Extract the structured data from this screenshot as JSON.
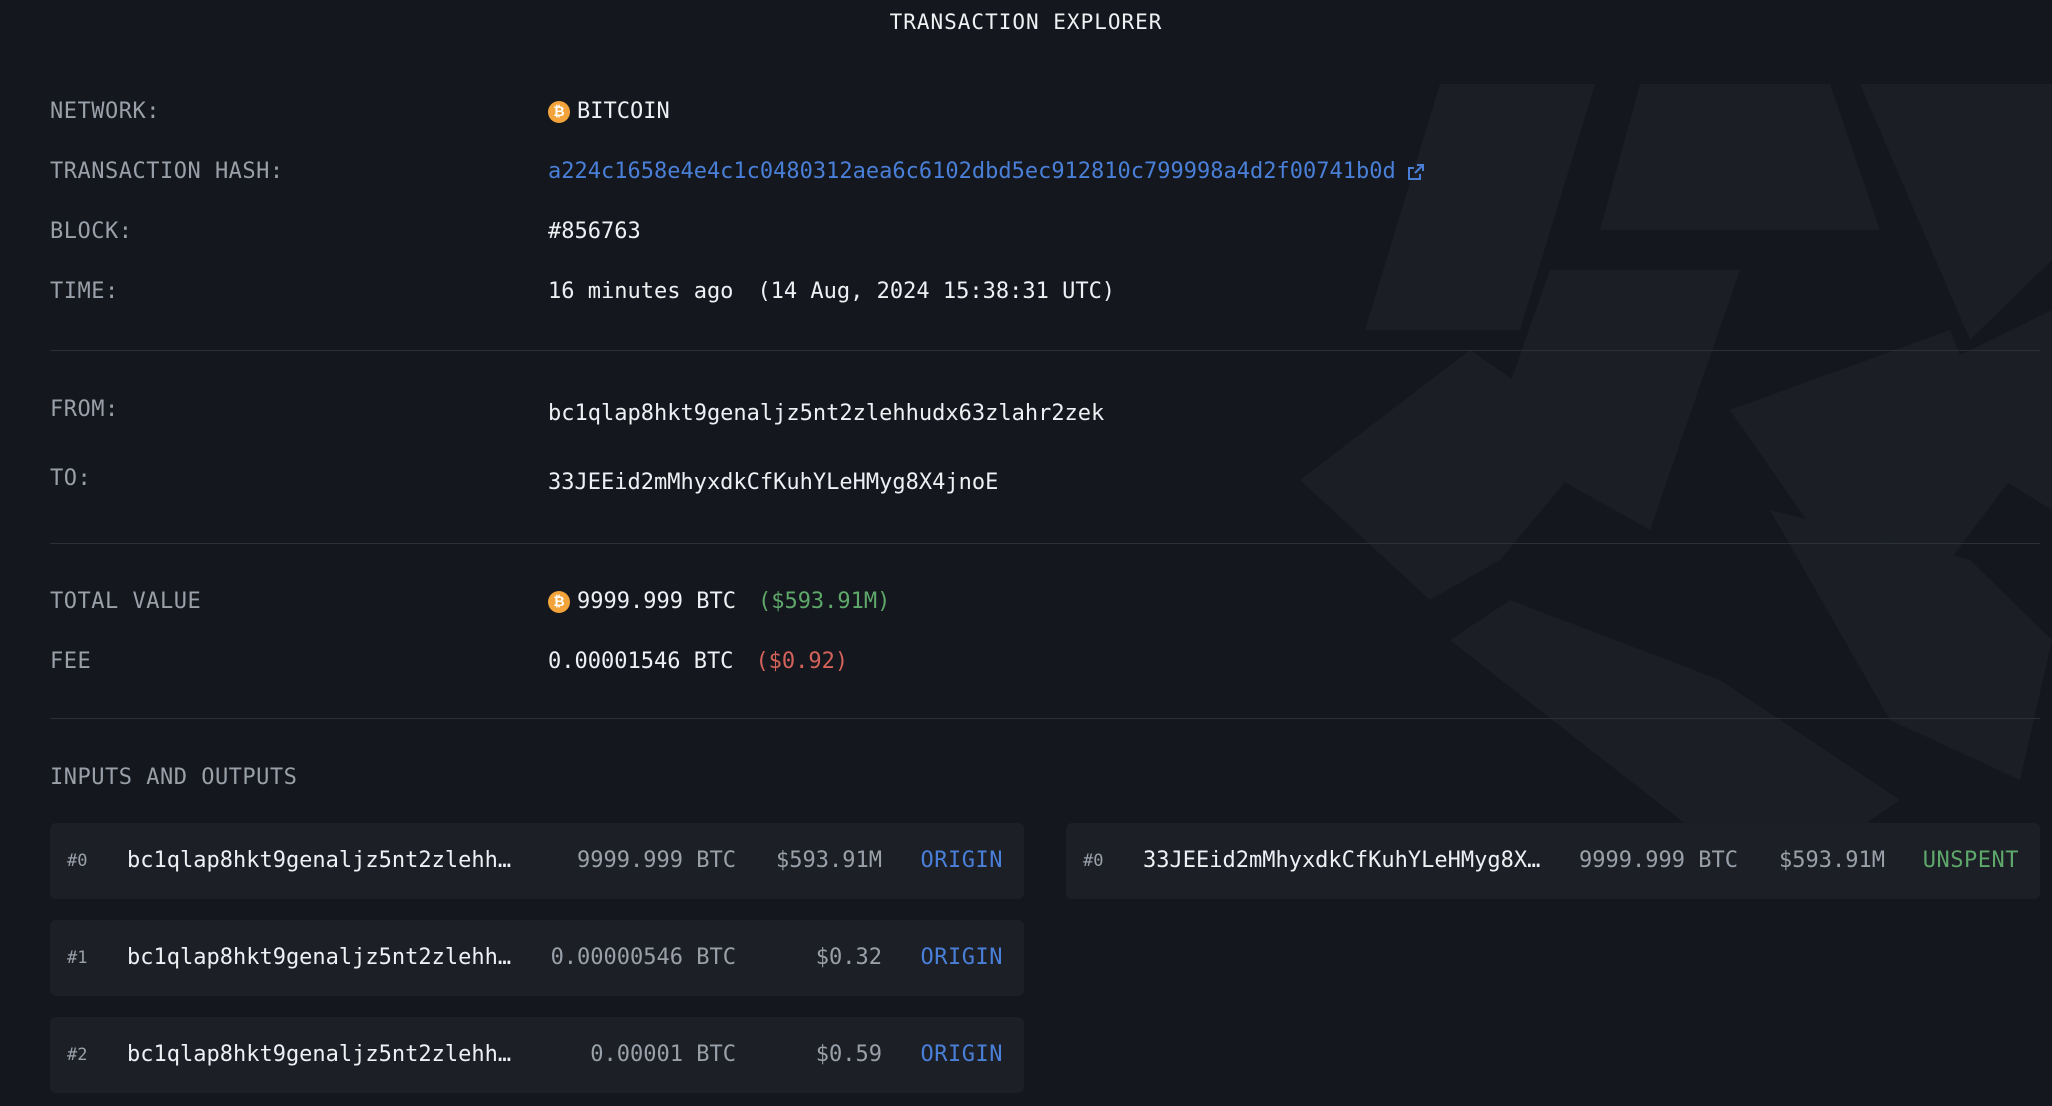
{
  "header": {
    "title": "TRANSACTION EXPLORER"
  },
  "details": {
    "network_label": "NETWORK:",
    "network_value": "BITCOIN",
    "network_icon": "bitcoin-icon",
    "hash_label": "TRANSACTION HASH:",
    "hash_value": "a224c1658e4e4c1c0480312aea6c6102dbd5ec912810c799998a4d2f00741b0d",
    "block_label": "BLOCK:",
    "block_value": "#856763",
    "time_label": "TIME:",
    "time_relative": "16 minutes ago",
    "time_absolute": "(14 Aug, 2024 15:38:31 UTC)"
  },
  "parties": {
    "from_label": "FROM:",
    "from_value": "bc1qlap8hkt9genaljz5nt2zlehhudx63zlahr2zek",
    "to_label": "TO:",
    "to_value": "33JEEid2mMhyxdkCfKuhYLeHMyg8X4jnoE"
  },
  "values": {
    "total_label": "TOTAL VALUE",
    "total_btc": "9999.999 BTC",
    "total_usd": "($593.91M)",
    "fee_label": "FEE",
    "fee_btc": "0.00001546 BTC",
    "fee_usd": "($0.92)"
  },
  "io": {
    "title": "INPUTS AND OUTPUTS",
    "inputs": [
      {
        "index": "#0",
        "address": "bc1qlap8hkt9genaljz5nt2zlehh…",
        "amount": "9999.999 BTC",
        "usd": "$593.91M",
        "status": "ORIGIN"
      },
      {
        "index": "#1",
        "address": "bc1qlap8hkt9genaljz5nt2zlehh…",
        "amount": "0.00000546 BTC",
        "usd": "$0.32",
        "status": "ORIGIN"
      },
      {
        "index": "#2",
        "address": "bc1qlap8hkt9genaljz5nt2zlehh…",
        "amount": "0.00001 BTC",
        "usd": "$0.59",
        "status": "ORIGIN"
      }
    ],
    "outputs": [
      {
        "index": "#0",
        "address": "33JEEid2mMhyxdkCfKuhYLeHMyg8X…",
        "amount": "9999.999 BTC",
        "usd": "$593.91M",
        "status": "UNSPENT"
      }
    ]
  },
  "colors": {
    "background": "#14171d",
    "link": "#4a7fd8",
    "positive": "#5fa86b",
    "negative": "#d2625a",
    "bitcoin": "#f2a33a"
  }
}
